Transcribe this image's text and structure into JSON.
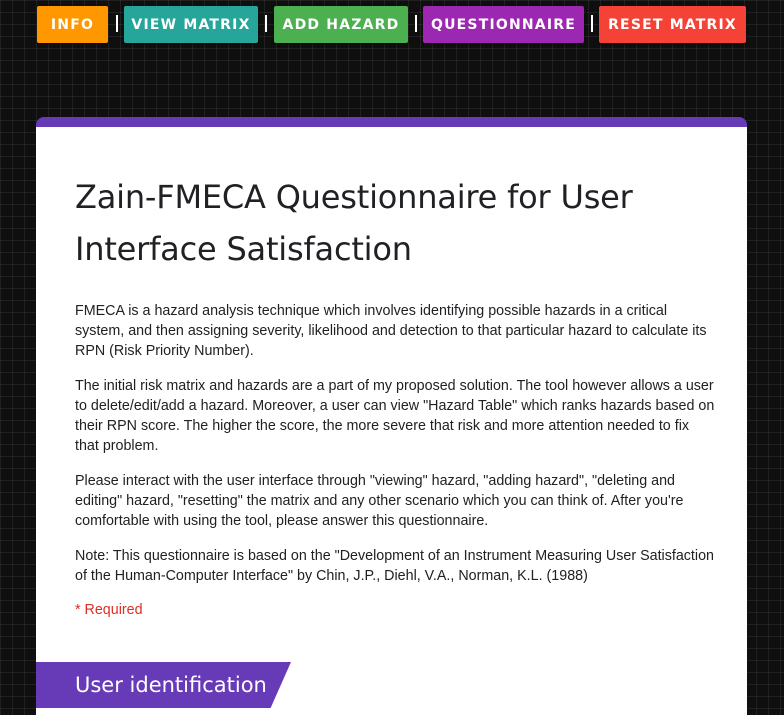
{
  "nav": {
    "info": {
      "label": "INFO",
      "color": "#ff9800"
    },
    "view_matrix": {
      "label": "VIEW MATRIX",
      "color": "#26a69a"
    },
    "add_hazard": {
      "label": "ADD HAZARD",
      "color": "#4caf50"
    },
    "questionnaire": {
      "label": "QUESTIONNAIRE",
      "color": "#9c27b0"
    },
    "reset_matrix": {
      "label": "RESET MATRIX",
      "color": "#f44336"
    }
  },
  "form": {
    "accent_color": "#673ab7",
    "title": "Zain-FMECA Questionnaire for User Interface Satisfaction",
    "description": [
      "FMECA is a hazard analysis technique which involves identifying possible hazards in a critical system, and then assigning severity, likelihood and detection to that particular hazard to calculate its RPN (Risk Priority Number).",
      "The initial risk matrix and hazards are a part of my proposed solution. The tool however allows a user to delete/edit/add a hazard. Moreover, a user can view \"Hazard Table\" which ranks hazards based on their RPN score. The higher the score, the more severe that risk and more attention needed to fix that problem.",
      "Please interact with the user interface through \"viewing\" hazard, \"adding hazard\", \"deleting and editing\" hazard, \"resetting\" the matrix and any other scenario which you can think of. After you're comfortable with using the tool, please answer this questionnaire.",
      "Note: This questionnaire is based on the \"Development of an Instrument Measuring User Satisfaction of the Human-Computer Interface\" by Chin, J.P., Diehl, V.A., Norman, K.L. (1988)"
    ],
    "required_note": "* Required",
    "required_color": "#d93025",
    "section_title": "User identification"
  }
}
